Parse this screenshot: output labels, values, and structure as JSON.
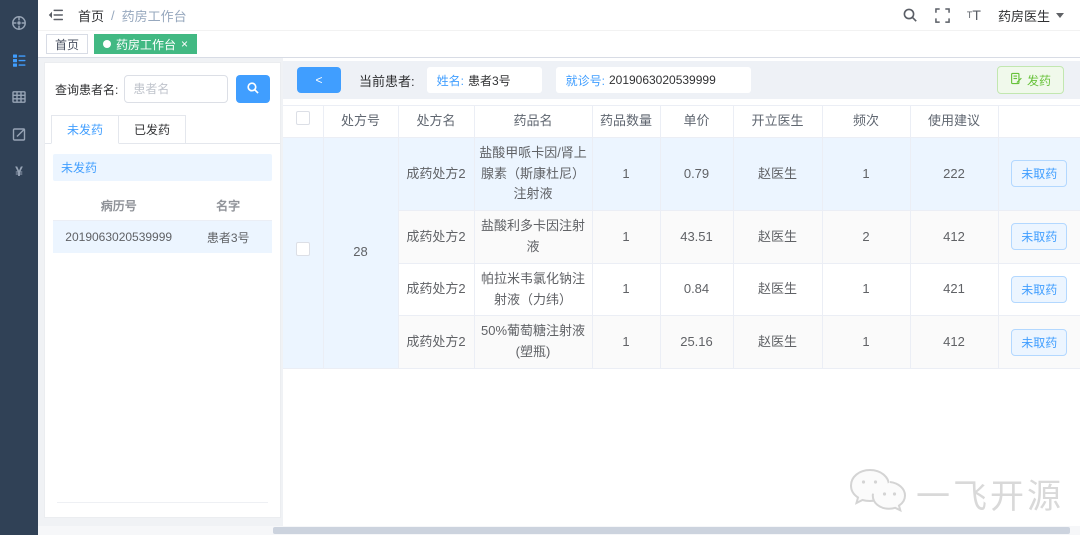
{
  "colors": {
    "primary_blue": "#409eff",
    "sidebar_bg": "#304156",
    "active_tag_green": "#42b983",
    "success_green": "#67c23a",
    "highlight_row_blue": "#ecf5ff"
  },
  "sidebar": {
    "items": [
      {
        "icon": "dashboard-icon",
        "active": false
      },
      {
        "icon": "worklist-icon",
        "active": true
      },
      {
        "icon": "table-icon",
        "active": false
      },
      {
        "icon": "form-edit-icon",
        "active": false
      },
      {
        "icon": "money-icon",
        "active": false,
        "glyph": "¥"
      }
    ]
  },
  "navbar": {
    "breadcrumb": {
      "home": "首页",
      "separator": "/",
      "current": "药房工作台"
    },
    "text_size_icon": {
      "small": "T",
      "big": "T"
    },
    "user_name": "药房医生"
  },
  "tags_view": {
    "tabs": [
      {
        "label": "首页",
        "active": false
      },
      {
        "label": "药房工作台",
        "active": true,
        "close_glyph": "×"
      }
    ]
  },
  "patient_panel": {
    "search_label": "查询患者名:",
    "search_placeholder": "患者名",
    "tabs": [
      {
        "label": "未发药",
        "active": true
      },
      {
        "label": "已发药",
        "active": false
      }
    ],
    "section_banner": "未发药",
    "table": {
      "headers": [
        "病历号",
        "名字"
      ],
      "rows": [
        {
          "record_no": "2019063020539999",
          "patient_name": "患者3号"
        }
      ]
    }
  },
  "workspace": {
    "back_button_glyph": "<",
    "current_patient_label": "当前患者:",
    "name_label": "姓名:",
    "name_value": "患者3号",
    "visit_label": "就诊号:",
    "visit_value": "2019063020539999",
    "dispense_button": "发药",
    "rx_table": {
      "headers": [
        "处方号",
        "处方名",
        "药品名",
        "药品数量",
        "单价",
        "开立医生",
        "频次",
        "使用建议"
      ],
      "prescription_no": "28",
      "rows": [
        {
          "prescription_name": "成药处方2",
          "drug_name": "盐酸甲哌卡因/肾上腺素（斯康杜尼）注射液",
          "quantity": "1",
          "unit_price": "0.79",
          "doctor": "赵医生",
          "frequency": "1",
          "advice": "222",
          "status": "未取药"
        },
        {
          "prescription_name": "成药处方2",
          "drug_name": "盐酸利多卡因注射液",
          "quantity": "1",
          "unit_price": "43.51",
          "doctor": "赵医生",
          "frequency": "2",
          "advice": "412",
          "status": "未取药"
        },
        {
          "prescription_name": "成药处方2",
          "drug_name": "帕拉米韦氯化钠注射液（力纬）",
          "quantity": "1",
          "unit_price": "0.84",
          "doctor": "赵医生",
          "frequency": "1",
          "advice": "421",
          "status": "未取药"
        },
        {
          "prescription_name": "成药处方2",
          "drug_name": "50%葡萄糖注射液(塑瓶)",
          "quantity": "1",
          "unit_price": "25.16",
          "doctor": "赵医生",
          "frequency": "1",
          "advice": "412",
          "status": "未取药"
        }
      ]
    }
  },
  "watermark": {
    "text": "一飞开源"
  }
}
